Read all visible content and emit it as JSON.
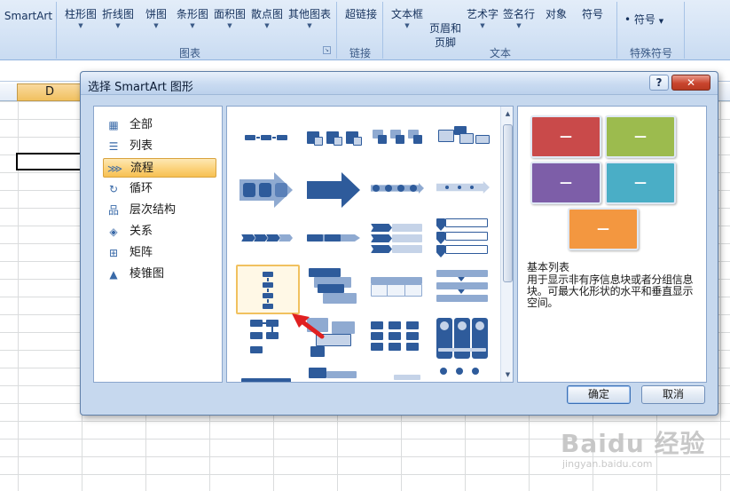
{
  "ribbon": {
    "smartart": "SmartArt",
    "charts": [
      "柱形图",
      "折线图",
      "饼图",
      "条形图",
      "面积图",
      "散点图",
      "其他图表"
    ],
    "link": "超链接",
    "textbox": "文本框",
    "header_footer": "页眉和\n页脚",
    "wordart": "艺术字",
    "signature": "签名行",
    "object": "对象",
    "symbol": "符号",
    "special_symbol_item": "符号",
    "group_labels": {
      "chart": "图表",
      "link": "链接",
      "text": "文本",
      "special": "特殊符号"
    }
  },
  "sheet": {
    "column_header": "D"
  },
  "dialog": {
    "title": "选择 SmartArt 图形",
    "help": "?",
    "close": "✕",
    "categories": [
      {
        "label": "全部",
        "icon": "all-icon"
      },
      {
        "label": "列表",
        "icon": "list-icon"
      },
      {
        "label": "流程",
        "icon": "process-icon",
        "selected": true
      },
      {
        "label": "循环",
        "icon": "cycle-icon"
      },
      {
        "label": "层次结构",
        "icon": "hierarchy-icon"
      },
      {
        "label": "关系",
        "icon": "relationship-icon"
      },
      {
        "label": "矩阵",
        "icon": "matrix-icon"
      },
      {
        "label": "棱锥图",
        "icon": "pyramid-icon"
      }
    ],
    "preview": {
      "name": "基本列表",
      "description": "用于显示非有序信息块或者分组信息块。可最大化形状的水平和垂直显示空间。",
      "box_label": "—",
      "colors": [
        "#c94a4a",
        "#9cbb4e",
        "#7d5ea8",
        "#4aaec6",
        "#f39740"
      ]
    },
    "ok": "确定",
    "cancel": "取消"
  },
  "watermark": {
    "logo": "Baidu 经验",
    "url": "jingyan.baidu.com"
  }
}
